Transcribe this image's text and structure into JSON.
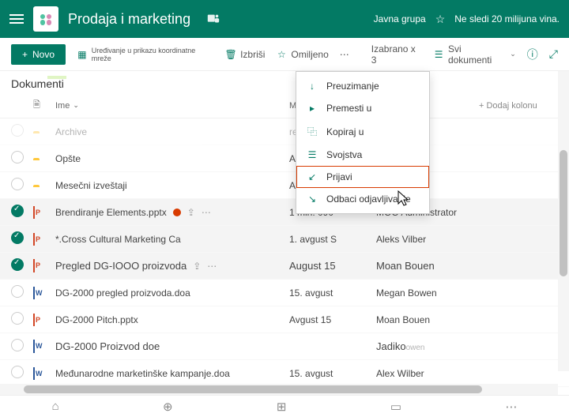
{
  "header": {
    "title": "Prodaja i marketing",
    "group_type": "Javna grupa",
    "follow_text": "Ne sledi 20 milijuna vina."
  },
  "toolbar": {
    "new_label": "Novo",
    "edit_grid": "Uređivanje u prikazu koordinatne mreže",
    "delete_label": "Izbriši",
    "favorite_label": "Omiljeno",
    "selected": "Izabrano x 3",
    "view": "Svi dokumenti"
  },
  "crumb": "Dokumenti",
  "columns": {
    "name": "Ime",
    "modified": "Modifi",
    "add": "Dodaj kolonu"
  },
  "rows": [
    {
      "type": "folder",
      "name": "Archive",
      "mod": "resteruay",
      "who": "",
      "sel": false,
      "faded": true
    },
    {
      "type": "folder",
      "name": "Opšte",
      "mod": "Augur (Augon)",
      "who": "",
      "sel": false
    },
    {
      "type": "folder",
      "name": "Mesečni izveštaji",
      "mod": "Avgust I",
      "who": "",
      "sel": false
    },
    {
      "type": "ppt",
      "name": "Brendiranje Elements.pptx",
      "mod": "1 min. 090",
      "who": "MOO Administrator",
      "sel": true,
      "status": true,
      "actions": true
    },
    {
      "type": "ppt",
      "name": "*.Cross Cultural Marketing Ca",
      "mod": "1. avgust S",
      "who": "Aleks Vilber",
      "sel": true
    },
    {
      "type": "ppt",
      "name": "Pregled DG-IOOO proizvoda",
      "mod": "August 15",
      "who": "Moan Bouen",
      "sel": true,
      "actions": true,
      "big": true
    },
    {
      "type": "doc",
      "name": "DG-2000 pregled proizvoda.doa",
      "mod": "15. avgust",
      "who": "Megan Bowen",
      "sel": false
    },
    {
      "type": "ppt",
      "name": "DG-2000 Pitch.pptx",
      "mod": "Avgust  15",
      "who": "Moan Bouen",
      "sel": false
    },
    {
      "type": "doc",
      "name": "DG-2000 Proizvod doe",
      "mod": "",
      "who": "Jadiko",
      "sel": false,
      "big": true,
      "whoextra": "owen"
    },
    {
      "type": "doc",
      "name": "Međunarodne marketinške kampanje.doa",
      "mod": "15. avgust",
      "who": "Alex Wilber",
      "sel": false
    }
  ],
  "menu": [
    {
      "icon": "↓",
      "label": "Preuzimanje"
    },
    {
      "icon": "▸",
      "label": "Premesti u"
    },
    {
      "icon": "⿻",
      "label": "Kopiraj u"
    },
    {
      "icon": "☰",
      "label": "Svojstva"
    },
    {
      "icon": "↙",
      "label": "Prijavi",
      "hl": true
    },
    {
      "icon": "↘",
      "label": "Odbaci odjavljivanje"
    }
  ]
}
